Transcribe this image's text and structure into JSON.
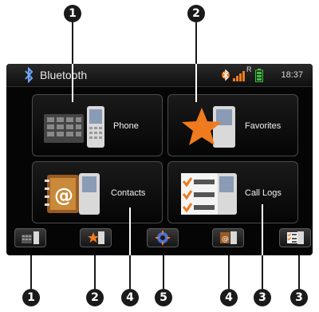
{
  "app": {
    "title": "Bluetooth",
    "time": "18:37",
    "signal_indicator": "R"
  },
  "tiles": [
    {
      "label": "Phone",
      "icon": "phone-keypad-icon"
    },
    {
      "label": "Favorites",
      "icon": "star-icon"
    },
    {
      "label": "Contacts",
      "icon": "address-book-icon"
    },
    {
      "label": "Call Logs",
      "icon": "call-log-icon"
    }
  ],
  "bottom_bar": [
    {
      "icon": "phone-keypad-icon"
    },
    {
      "icon": "star-icon"
    },
    {
      "icon": "settings-gear-icon"
    },
    {
      "icon": "address-book-icon"
    },
    {
      "icon": "call-log-icon"
    }
  ],
  "callouts": {
    "top": [
      "1",
      "2"
    ],
    "bottom": [
      "1",
      "2",
      "4",
      "5",
      "4",
      "3",
      "3"
    ]
  },
  "colors": {
    "accent_star": "#f07a1e",
    "battery": "#3fbf3f",
    "screen_bg": "#050505"
  }
}
